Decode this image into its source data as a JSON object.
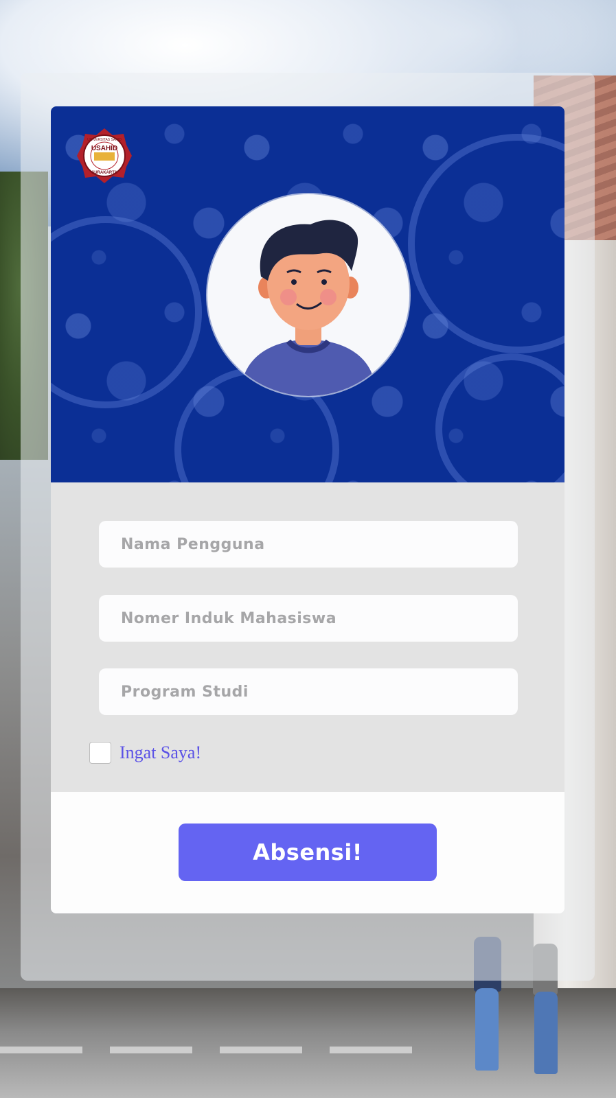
{
  "header": {
    "logo": {
      "icon": "usahid-logo",
      "text_top": "UNIVERSITAS SAHID",
      "text_center": "USAHID",
      "text_bottom": "SURAKARTA"
    },
    "avatar": {
      "icon": "user-avatar-icon"
    }
  },
  "form": {
    "username_placeholder": "Nama Pengguna",
    "nim_placeholder": "Nomer Induk Mahasiswa",
    "program_placeholder": "Program Studi",
    "remember_label": "Ingat Saya!",
    "remember_checked": false
  },
  "actions": {
    "submit_label": "Absensi!"
  },
  "colors": {
    "header_bg": "#0b2f95",
    "form_bg": "#e3e3e3",
    "button_bg": "#6464f2",
    "label_color": "#5b52e6"
  }
}
